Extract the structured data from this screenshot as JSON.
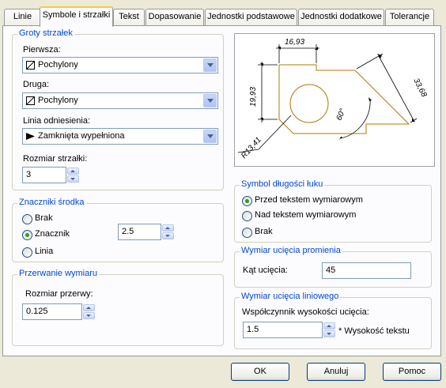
{
  "tabs": [
    "Linie",
    "Symbole i strzałki",
    "Tekst",
    "Dopasowanie",
    "Jednostki podstawowe",
    "Jednostki dodatkowe",
    "Tolerancje"
  ],
  "arrowheads": {
    "legend": "Groty strzałek",
    "first_label": "Pierwsza:",
    "first_value": "Pochylony",
    "second_label": "Druga:",
    "second_value": "Pochylony",
    "leader_label": "Linia odniesienia:",
    "leader_value": "Zamknięta wypełniona",
    "size_label": "Rozmiar strzałki:",
    "size_value": "3"
  },
  "center_marks": {
    "legend": "Znaczniki środka",
    "options": [
      "Brak",
      "Znacznik",
      "Linia"
    ],
    "selected": "Znacznik",
    "size_value": "2.5"
  },
  "dimension_break": {
    "legend": "Przerwanie wymiaru",
    "size_label": "Rozmiar przerwy:",
    "size_value": "0.125"
  },
  "preview": {
    "dims": [
      "16,93",
      "19,93",
      "33,68",
      "60°",
      "R13,41"
    ],
    "colors": {
      "geometry": "#b07800",
      "dimension": "#000000"
    }
  },
  "arc_length_symbol": {
    "legend": "Symbol długości łuku",
    "options": [
      "Przed tekstem wymiarowym",
      "Nad tekstem wymiarowym",
      "Brak"
    ],
    "selected": "Przed tekstem wymiarowym"
  },
  "radius_jog": {
    "legend": "Wymiar ucięcia promienia",
    "angle_label": "Kąt ucięcia:",
    "angle_value": "45"
  },
  "linear_jog": {
    "legend": "Wymiar ucięcia liniowego",
    "factor_label": "Współczynnik wysokości ucięcia:",
    "factor_value": "1.5",
    "suffix": "* Wysokość tekstu"
  },
  "buttons": {
    "ok": "OK",
    "cancel": "Anuluj",
    "help": "Pomoc"
  },
  "accent_color": "#0046d5"
}
